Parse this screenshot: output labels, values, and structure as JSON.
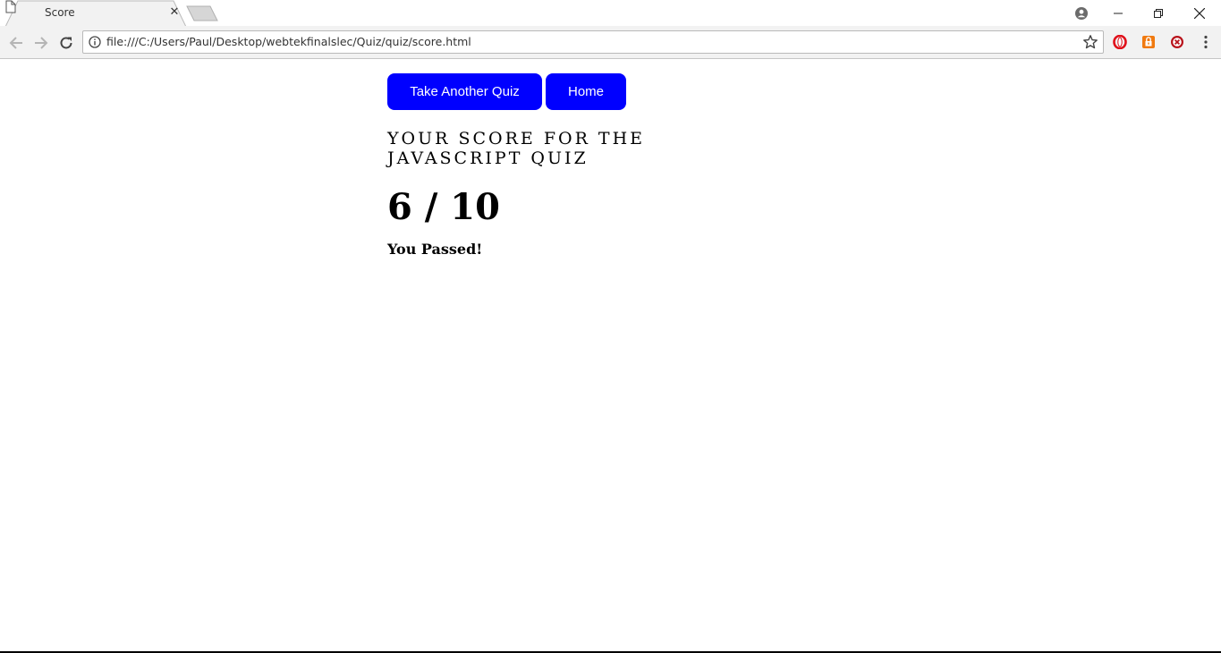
{
  "browser": {
    "tab": {
      "title": "Score",
      "close_glyph": "✕"
    },
    "address_bar": {
      "url": "file:///C:/Users/Paul/Desktop/webtekfinalslec/Quiz/quiz/score.html"
    },
    "icons": {
      "tab_favicon": "page-icon",
      "profile": "user-icon",
      "back": "arrow-left-icon",
      "forward": "arrow-right-icon",
      "reload": "reload-icon",
      "info": "info-icon",
      "bookmark": "star-icon",
      "extensions": [
        "opera-icon",
        "lock-extension-icon",
        "block-extension-icon"
      ],
      "menu": "kebab-menu-icon"
    },
    "colors": {
      "chrome": "#f2f2f2",
      "opera_red": "#e0101a",
      "ext_orange": "#f07a10"
    }
  },
  "page": {
    "buttons": {
      "take_another_quiz": "Take Another Quiz",
      "home": "Home"
    },
    "heading": "YOUR SCORE FOR THE JAVASCRIPT QUIZ",
    "score": "6 / 10",
    "result": "You Passed!",
    "colors": {
      "button_bg": "#0000ff",
      "button_text": "#ffffff"
    }
  }
}
